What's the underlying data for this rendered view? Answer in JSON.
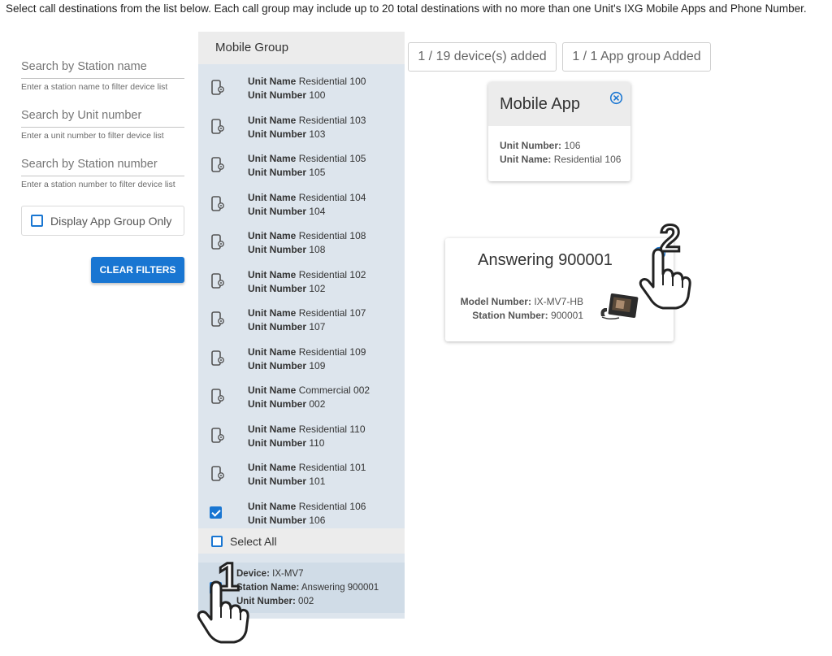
{
  "instructions": "Select call destinations from the list below. Each call group may include up to 20 total destinations with no more than one Unit's IXG Mobile Apps and Phone Number.",
  "filters": {
    "station_name": {
      "placeholder": "Search by Station name",
      "hint": "Enter a station name to filter device list"
    },
    "unit_number": {
      "placeholder": "Search by Unit number",
      "hint": "Enter a unit number to filter device list"
    },
    "station_number": {
      "placeholder": "Search by Station number",
      "hint": "Enter a station number to filter device list"
    },
    "app_group_only": {
      "label": "Display App Group Only",
      "checked": false
    },
    "clear_label": "CLEAR FILTERS"
  },
  "device_list": {
    "header": "Mobile Group",
    "unit_name_label": "Unit Name",
    "unit_number_label": "Unit Number",
    "items": [
      {
        "unit_name": "Residential 100",
        "unit_number": "100",
        "checked": false
      },
      {
        "unit_name": "Residential 103",
        "unit_number": "103",
        "checked": false
      },
      {
        "unit_name": "Residential 105",
        "unit_number": "105",
        "checked": false
      },
      {
        "unit_name": "Residential 104",
        "unit_number": "104",
        "checked": false
      },
      {
        "unit_name": "Residential 108",
        "unit_number": "108",
        "checked": false
      },
      {
        "unit_name": "Residential 102",
        "unit_number": "102",
        "checked": false
      },
      {
        "unit_name": "Residential 107",
        "unit_number": "107",
        "checked": false
      },
      {
        "unit_name": "Residential 109",
        "unit_number": "109",
        "checked": false
      },
      {
        "unit_name": "Commercial 002",
        "unit_number": "002",
        "checked": false
      },
      {
        "unit_name": "Residential 110",
        "unit_number": "110",
        "checked": false
      },
      {
        "unit_name": "Residential 101",
        "unit_number": "101",
        "checked": false
      },
      {
        "unit_name": "Residential 106",
        "unit_number": "106",
        "checked": true
      }
    ],
    "select_all_label": "Select All",
    "station": {
      "device_label": "Device:",
      "device": "IX-MV7",
      "station_name_label": "Station Name:",
      "station_name": "Answering 900001",
      "unit_number_label": "Unit Number:",
      "unit_number": "002",
      "checked": true
    }
  },
  "counters": {
    "devices": "1 / 19 device(s) added",
    "app_groups": "1 / 1 App group Added"
  },
  "mobile_app_card": {
    "title": "Mobile App",
    "unit_number_label": "Unit Number:",
    "unit_number": "106",
    "unit_name_label": "Unit Name:",
    "unit_name": "Residential 106"
  },
  "answering_card": {
    "title": "Answering 900001",
    "model_label": "Model Number:",
    "model": "IX-MV7-HB",
    "station_label": "Station Number:",
    "station": "900001"
  },
  "annotations": {
    "step1": "1",
    "step2": "2"
  },
  "colors": {
    "accent": "#1976d2",
    "panel": "#dde5ed"
  }
}
